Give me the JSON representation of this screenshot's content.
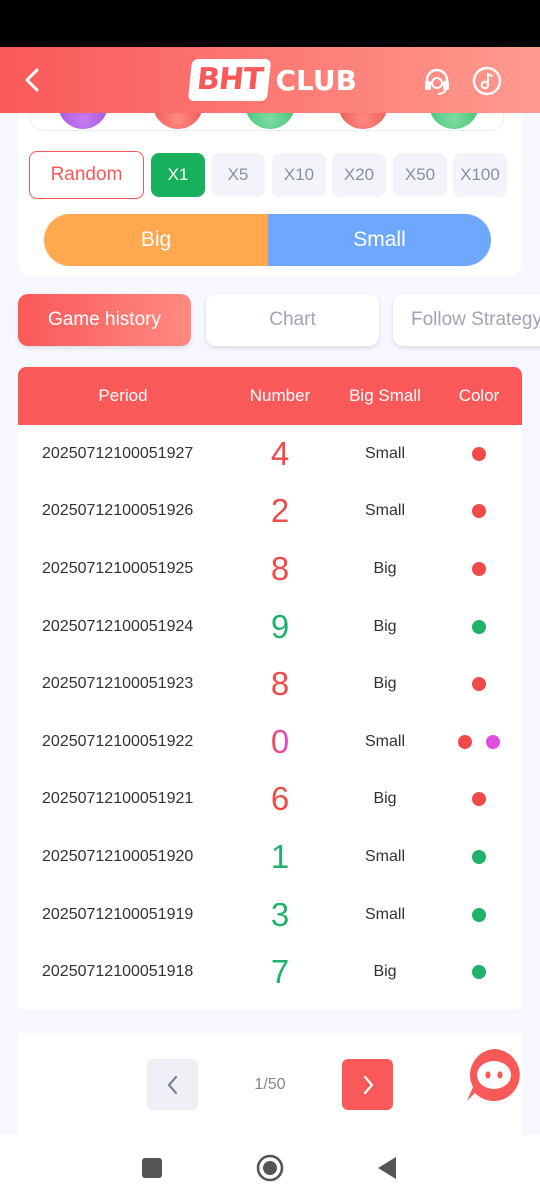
{
  "header": {
    "logo_main": "BHT",
    "logo_sub": "CLUB",
    "colors": {
      "gradient_start": "#f95959",
      "gradient_end": "#ff9a8e"
    }
  },
  "multipliers": {
    "random_label": "Random",
    "options": [
      "X1",
      "X5",
      "X10",
      "X20",
      "X50",
      "X100"
    ],
    "selected": "X1"
  },
  "bet_size": {
    "big_label": "Big",
    "small_label": "Small"
  },
  "tabs": [
    "Game history",
    "Chart",
    "Follow Strategy"
  ],
  "table": {
    "headers": [
      "Period",
      "Number",
      "Big Small",
      "Color"
    ],
    "rows": [
      {
        "period": "20250712100051927",
        "number": "4",
        "big_small": "Small",
        "colors": [
          "red"
        ]
      },
      {
        "period": "20250712100051926",
        "number": "2",
        "big_small": "Small",
        "colors": [
          "red"
        ]
      },
      {
        "period": "20250712100051925",
        "number": "8",
        "big_small": "Big",
        "colors": [
          "red"
        ]
      },
      {
        "period": "20250712100051924",
        "number": "9",
        "big_small": "Big",
        "colors": [
          "green"
        ]
      },
      {
        "period": "20250712100051923",
        "number": "8",
        "big_small": "Big",
        "colors": [
          "red"
        ]
      },
      {
        "period": "20250712100051922",
        "number": "0",
        "big_small": "Small",
        "colors": [
          "red",
          "violet"
        ]
      },
      {
        "period": "20250712100051921",
        "number": "6",
        "big_small": "Big",
        "colors": [
          "red"
        ]
      },
      {
        "period": "20250712100051920",
        "number": "1",
        "big_small": "Small",
        "colors": [
          "green"
        ]
      },
      {
        "period": "20250712100051919",
        "number": "3",
        "big_small": "Small",
        "colors": [
          "green"
        ]
      },
      {
        "period": "20250712100051918",
        "number": "7",
        "big_small": "Big",
        "colors": [
          "green"
        ]
      }
    ]
  },
  "pagination": {
    "text": "1/50"
  },
  "palette": {
    "red": "#f04a4a",
    "green": "#20b26b",
    "violet": "#df4ee0",
    "big": "#ffa84f",
    "small": "#6ea8fe",
    "active_multiplier": "#17b15e"
  },
  "icons": [
    "back-arrow-icon",
    "headset-support-icon",
    "music-note-icon",
    "chevron-left-icon",
    "chevron-right-icon",
    "chat-bubble-icon",
    "nav-recent-icon",
    "nav-home-icon",
    "nav-back-icon"
  ]
}
